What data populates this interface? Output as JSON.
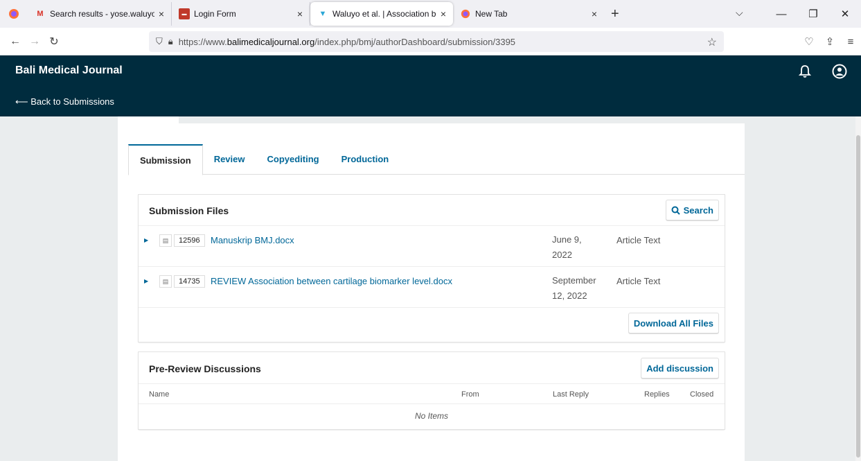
{
  "browser": {
    "tabs": [
      {
        "title": "Search results - yose.waluyo@",
        "icon": "gmail-icon"
      },
      {
        "title": "Login Form",
        "icon": "login-favicon"
      },
      {
        "title": "Waluyo et al. | Association betw",
        "icon": "ojs-favicon"
      },
      {
        "title": "New Tab",
        "icon": "firefox-icon"
      }
    ],
    "url_prefix": "https://www.",
    "url_host": "balimedicaljournal.org",
    "url_path": "/index.php/bmj/authorDashboard/submission/3395"
  },
  "header": {
    "site_title": "Bali Medical Journal",
    "back_label": "⟵ Back to Submissions"
  },
  "workflow_tabs": [
    "Submission",
    "Review",
    "Copyediting",
    "Production"
  ],
  "submission_files": {
    "title": "Submission Files",
    "search_label": "Search",
    "download_all_label": "Download All Files",
    "files": [
      {
        "id": "12596",
        "name": "Manuskrip BMJ.docx",
        "date_line1": "June 9,",
        "date_line2": "2022",
        "type": "Article Text"
      },
      {
        "id": "14735",
        "name": "REVIEW Association between cartilage biomarker level.docx",
        "date_line1": "September",
        "date_line2": "12, 2022",
        "type": "Article Text"
      }
    ]
  },
  "discussions": {
    "title": "Pre-Review Discussions",
    "add_label": "Add discussion",
    "columns": [
      "Name",
      "From",
      "Last Reply",
      "Replies",
      "Closed"
    ],
    "empty_text": "No Items"
  },
  "colors": {
    "header_bg": "#002c3e",
    "link": "#006798"
  }
}
